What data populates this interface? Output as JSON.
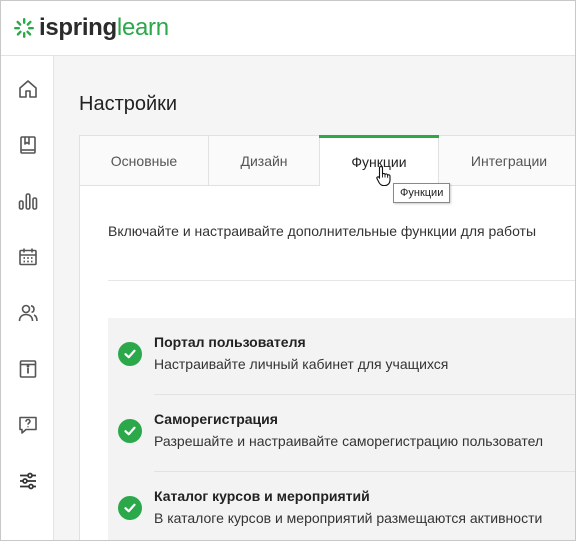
{
  "app": {
    "logo_part1": "ispring",
    "logo_part2": "learn",
    "brand_color": "#2aa84a"
  },
  "sidebar": {
    "items": [
      {
        "icon": "home-icon"
      },
      {
        "icon": "book-icon"
      },
      {
        "icon": "chart-icon"
      },
      {
        "icon": "calendar-icon"
      },
      {
        "icon": "users-icon"
      },
      {
        "icon": "info-icon"
      },
      {
        "icon": "help-icon"
      },
      {
        "icon": "settings-icon",
        "active": true
      }
    ]
  },
  "page": {
    "title": "Настройки"
  },
  "tabs": [
    {
      "label": "Основные"
    },
    {
      "label": "Дизайн"
    },
    {
      "label": "Функции",
      "active": true
    },
    {
      "label": "Интеграции"
    }
  ],
  "tooltip": "Функции",
  "content": {
    "description": "Включайте и настраивайте дополнительные функции для работы"
  },
  "features": [
    {
      "title": "Портал пользователя",
      "subtitle": "Настраивайте личный кабинет для учащихся",
      "enabled": true
    },
    {
      "title": "Саморегистрация",
      "subtitle": "Разрешайте и настраивайте саморегистрацию пользовател",
      "enabled": true
    },
    {
      "title": "Каталог курсов и мероприятий",
      "subtitle": "В каталоге курсов и мероприятий размещаются активности",
      "enabled": true
    }
  ]
}
